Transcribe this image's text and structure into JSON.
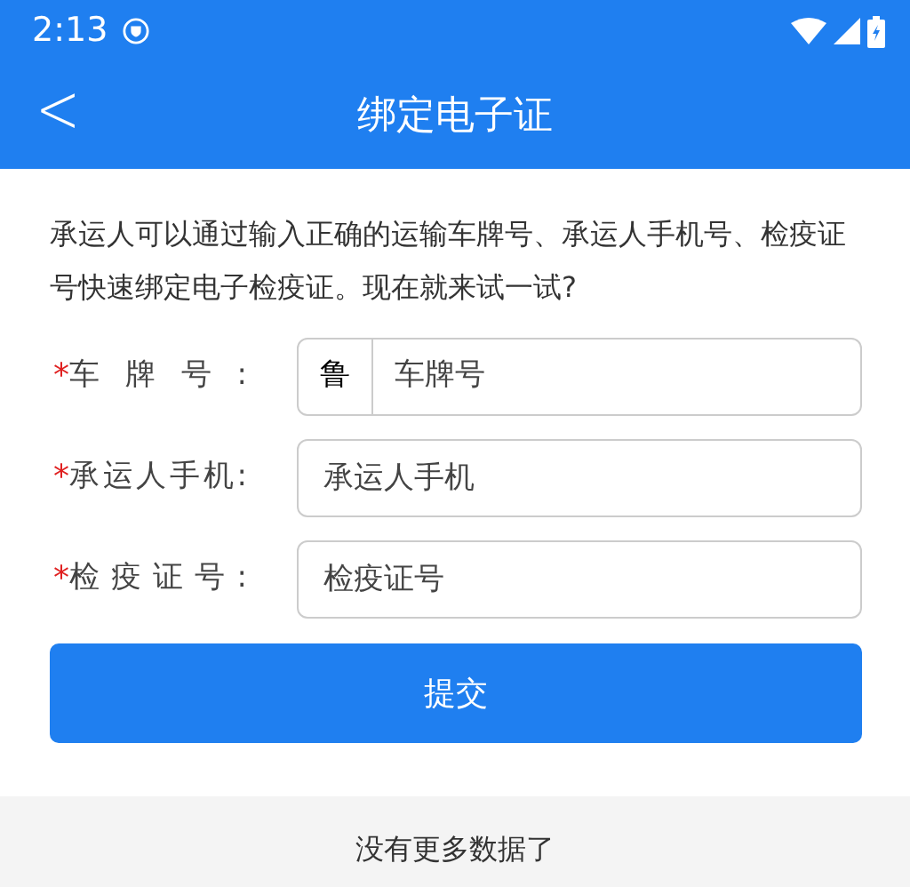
{
  "status_bar": {
    "time": "2:13"
  },
  "header": {
    "back": "<",
    "title": "绑定电子证"
  },
  "intro": "承运人可以通过输入正确的运输车牌号、承运人手机号、检疫证号快速绑定电子检疫证。现在就来试一试?",
  "form": [
    {
      "required": "*",
      "label": "车牌号:",
      "prefix": "鲁",
      "placeholder": "车牌号"
    },
    {
      "required": "*",
      "label": "承运人手机:",
      "placeholder": "承运人手机"
    },
    {
      "required": "*",
      "label": "检疫证号:",
      "placeholder": "检疫证号"
    }
  ],
  "submit": "提交",
  "footer": "没有更多数据了"
}
